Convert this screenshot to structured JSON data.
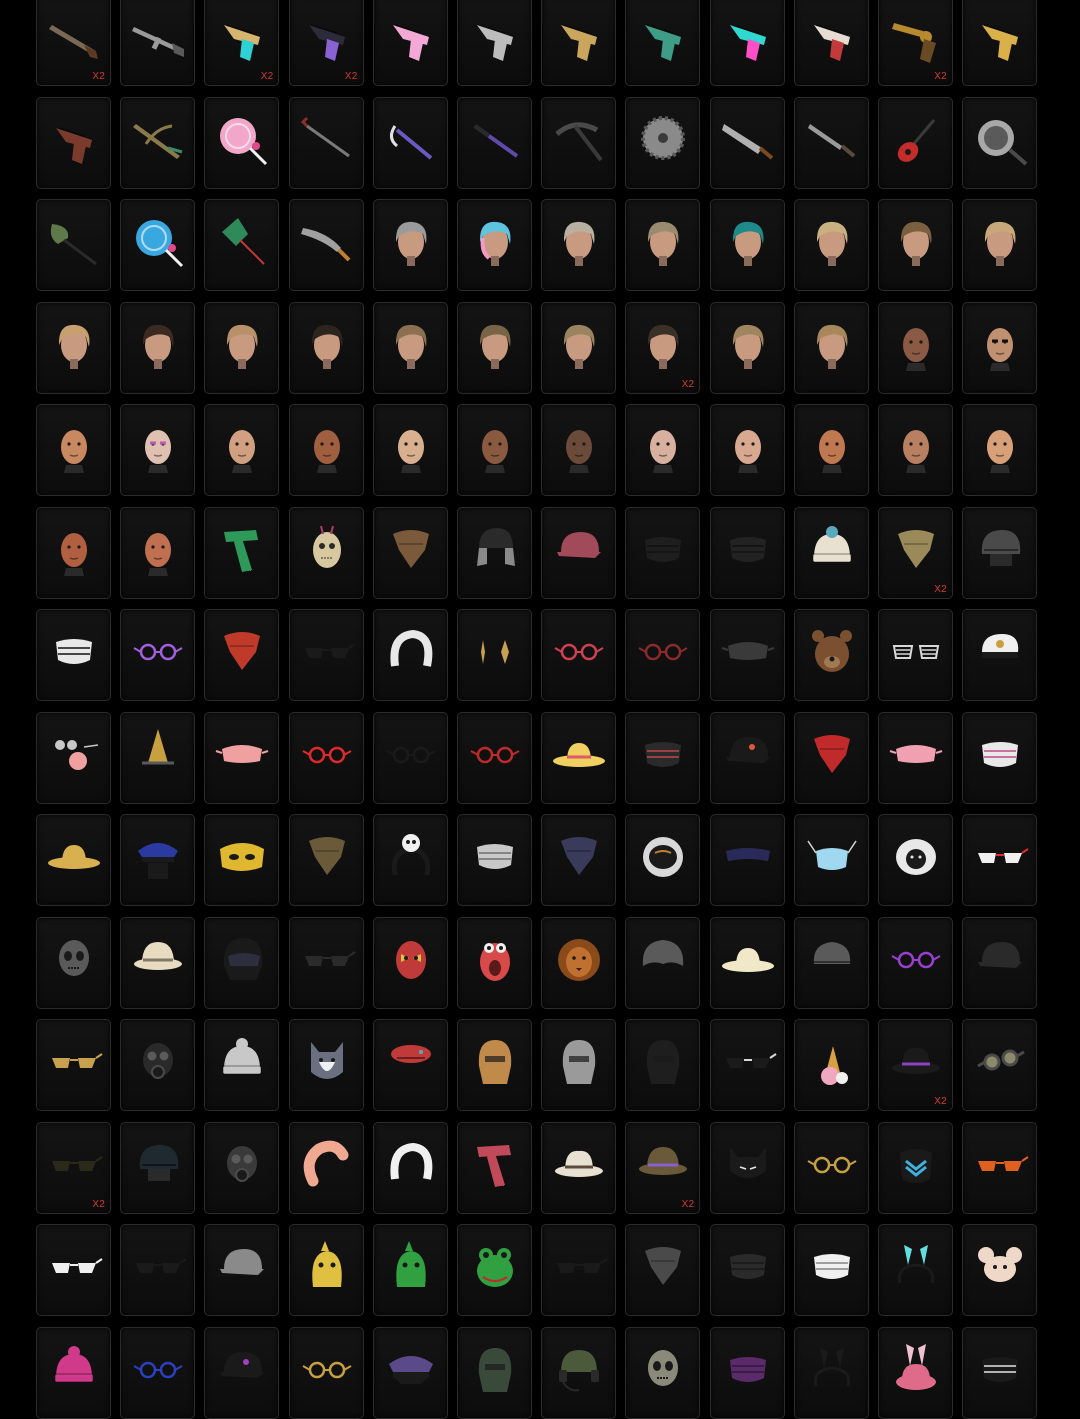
{
  "inventory": {
    "quantity_badge": "X2",
    "colors": {
      "background": "#000000",
      "slot_border": "#2b2b2b",
      "quantity_text": "#d23a2e"
    },
    "items": [
      {
        "icon": "shotgun-icon",
        "color": "#7a6a55"
      },
      {
        "icon": "assault-rifle-icon",
        "color": "#9a9a9a"
      },
      {
        "icon": "pistol-icon",
        "color": "#d6b56e",
        "accent": "#2fd0d6"
      },
      {
        "icon": "pistol-icon",
        "color": "#2b2b3a",
        "accent": "#8a63d2"
      },
      {
        "icon": "pistol-icon",
        "color": "#f3a8d6"
      },
      {
        "icon": "pistol-icon",
        "color": "#bcbcbc"
      },
      {
        "icon": "pistol-icon",
        "color": "#c9a65c"
      },
      {
        "icon": "pistol-icon",
        "color": "#3f9c86"
      },
      {
        "icon": "pistol-icon",
        "color": "#2ed9cf",
        "accent": "#ff4fc8"
      },
      {
        "icon": "pistol-icon",
        "color": "#e6dcd2",
        "accent": "#c33a3a"
      },
      {
        "icon": "revolver-icon",
        "color": "#b88a2e"
      },
      {
        "icon": "pistol-icon",
        "color": "#d9b04a"
      },
      {
        "icon": "pistol-icon",
        "color": "#7a3b2c"
      },
      {
        "icon": "crossbow-icon",
        "color": "#8a7a4a"
      },
      {
        "icon": "lollipop-icon",
        "color": "#f2a6c9"
      },
      {
        "icon": "crowbar-icon",
        "color": "#8a2e2e"
      },
      {
        "icon": "sickle-icon",
        "color": "#6a5ac0"
      },
      {
        "icon": "baton-icon",
        "color": "#5e4aa8"
      },
      {
        "icon": "pickaxe-icon",
        "color": "#4a4a4a"
      },
      {
        "icon": "sawblade-icon",
        "color": "#8a8a8a"
      },
      {
        "icon": "machete-icon",
        "color": "#b0b0b0"
      },
      {
        "icon": "knife-icon",
        "color": "#9a9a9a"
      },
      {
        "icon": "guitar-icon",
        "color": "#c42b2b"
      },
      {
        "icon": "frying-pan-icon",
        "color": "#a8a8a8"
      },
      {
        "icon": "shovel-icon",
        "color": "#5f7a4a"
      },
      {
        "icon": "lollipop-icon",
        "color": "#3aa8e0"
      },
      {
        "icon": "flyswatter-icon",
        "color": "#2f8a5a",
        "accent": "#c43a3a"
      },
      {
        "icon": "kukri-icon",
        "color": "#a0a0a0"
      },
      {
        "icon": "hair-icon",
        "color": "#9a9a9a"
      },
      {
        "icon": "hair-icon",
        "color": "#5fc4e0",
        "accent": "#f29ac4"
      },
      {
        "icon": "hair-icon",
        "color": "#b8b0a0"
      },
      {
        "icon": "hair-icon",
        "color": "#9a8a70"
      },
      {
        "icon": "hair-icon",
        "color": "#1f8a8a"
      },
      {
        "icon": "hair-icon",
        "color": "#c8b080"
      },
      {
        "icon": "hair-icon",
        "color": "#7a6040"
      },
      {
        "icon": "hair-icon",
        "color": "#c8a878"
      },
      {
        "icon": "hair-icon",
        "color": "#c8a070"
      },
      {
        "icon": "hair-icon",
        "color": "#3a2a22"
      },
      {
        "icon": "hair-icon",
        "color": "#b8906a"
      },
      {
        "icon": "hair-icon",
        "color": "#2e241e"
      },
      {
        "icon": "hair-icon",
        "color": "#8a7050"
      },
      {
        "icon": "hair-icon",
        "color": "#7a6448"
      },
      {
        "icon": "hair-icon",
        "color": "#9a8460"
      },
      {
        "icon": "hair-icon",
        "color": "#3a3028"
      },
      {
        "icon": "hair-icon",
        "color": "#a08660"
      },
      {
        "icon": "hair-icon",
        "color": "#a8885a"
      },
      {
        "icon": "face-icon",
        "color": "#8a5a44"
      },
      {
        "icon": "face-icon",
        "color": "#c09070",
        "accent": "#111111"
      },
      {
        "icon": "face-icon",
        "color": "#c88860"
      },
      {
        "icon": "face-icon",
        "color": "#e0c0b0",
        "accent": "#b85ab8"
      },
      {
        "icon": "face-icon",
        "color": "#d0a080"
      },
      {
        "icon": "face-icon",
        "color": "#a06040"
      },
      {
        "icon": "face-icon",
        "color": "#d8b090"
      },
      {
        "icon": "face-icon",
        "color": "#8a5a40"
      },
      {
        "icon": "face-icon",
        "color": "#6a4a38"
      },
      {
        "icon": "face-icon",
        "color": "#d8b0a0"
      },
      {
        "icon": "face-icon",
        "color": "#d8a890"
      },
      {
        "icon": "face-icon",
        "color": "#c07850"
      },
      {
        "icon": "face-icon",
        "color": "#b88060"
      },
      {
        "icon": "face-icon",
        "color": "#d8a078"
      },
      {
        "icon": "face-icon",
        "color": "#b06040"
      },
      {
        "icon": "face-icon",
        "color": "#c07050"
      },
      {
        "icon": "scarf-icon",
        "color": "#2e9a5a"
      },
      {
        "icon": "voodoo-mask-icon",
        "color": "#d8c8a0",
        "accent": "#b03a6a"
      },
      {
        "icon": "bandana-icon",
        "color": "#7a5a3a"
      },
      {
        "icon": "trapper-hat-icon",
        "color": "#2a2a2a"
      },
      {
        "icon": "cap-icon",
        "color": "#a04a5a"
      },
      {
        "icon": "face-mask-icon",
        "color": "#1e1e1e"
      },
      {
        "icon": "face-mask-icon",
        "color": "#222222"
      },
      {
        "icon": "beanie-icon",
        "color": "#e8e0d0",
        "accent": "#5aa8c0"
      },
      {
        "icon": "bandana-icon",
        "color": "#9a8a5a"
      },
      {
        "icon": "helmet-icon",
        "color": "#4a4a4a"
      },
      {
        "icon": "face-mask-icon",
        "color": "#e8e8e8",
        "accent": "#111111"
      },
      {
        "icon": "glasses-icon",
        "color": "#a060e0"
      },
      {
        "icon": "bandana-icon",
        "color": "#c03a2a"
      },
      {
        "icon": "sunglasses-icon",
        "color": "#1a1a1a"
      },
      {
        "icon": "headband-icon",
        "color": "#e8e8e8"
      },
      {
        "icon": "earrings-icon",
        "color": "#c8a050"
      },
      {
        "icon": "glasses-icon",
        "color": "#d04050"
      },
      {
        "icon": "glasses-icon",
        "color": "#8a2a2a"
      },
      {
        "icon": "eye-mask-icon",
        "color": "#3a3a3a"
      },
      {
        "icon": "bear-mask-icon",
        "color": "#7a5030"
      },
      {
        "icon": "shutter-shades-icon",
        "color": "#d8d8d8"
      },
      {
        "icon": "captain-hat-icon",
        "color": "#f0f0f0",
        "accent": "#c8a040"
      },
      {
        "icon": "clown-nose-icon",
        "color": "#f0a0a0"
      },
      {
        "icon": "witch-hat-icon",
        "color": "#c8a040"
      },
      {
        "icon": "eye-mask-icon",
        "color": "#f0a0a0"
      },
      {
        "icon": "glasses-icon",
        "color": "#e02a2a"
      },
      {
        "icon": "glasses-icon",
        "color": "#1a1a1a"
      },
      {
        "icon": "glasses-icon",
        "color": "#c02a2a"
      },
      {
        "icon": "sun-hat-icon",
        "color": "#f0d060",
        "accent": "#e05a6a"
      },
      {
        "icon": "face-mask-icon",
        "color": "#2a2a2a",
        "accent": "#c04a4a"
      },
      {
        "icon": "cap-icon",
        "color": "#1a1a1a",
        "accent": "#e05a3a"
      },
      {
        "icon": "bandana-icon",
        "color": "#c02a2a"
      },
      {
        "icon": "eye-mask-icon",
        "color": "#f0a0b0"
      },
      {
        "icon": "face-mask-icon",
        "color": "#e8e8e8",
        "accent": "#c04a8a"
      },
      {
        "icon": "sun-hat-icon",
        "color": "#d8b050"
      },
      {
        "icon": "police-cap-icon",
        "color": "#2a3aa0"
      },
      {
        "icon": "masquerade-mask-icon",
        "color": "#e0b830"
      },
      {
        "icon": "bandana-icon",
        "color": "#6a5a3a"
      },
      {
        "icon": "panda-headband-icon",
        "color": "#f0f0f0"
      },
      {
        "icon": "face-mask-icon",
        "color": "#c8c8c8"
      },
      {
        "icon": "bandana-icon",
        "color": "#3a3a5a"
      },
      {
        "icon": "space-helmet-icon",
        "color": "#d8d8d8",
        "accent": "#c08030"
      },
      {
        "icon": "visor-icon",
        "color": "#2a2a5a"
      },
      {
        "icon": "medical-mask-icon",
        "color": "#a0d8f0"
      },
      {
        "icon": "sheep-mask-icon",
        "color": "#e8e8e8"
      },
      {
        "icon": "sunglasses-icon",
        "color": "#f0f0f0",
        "accent": "#e02a2a"
      },
      {
        "icon": "skull-mask-icon",
        "color": "#5a5a5a"
      },
      {
        "icon": "pith-helmet-icon",
        "color": "#e8dcc0"
      },
      {
        "icon": "motorcycle-helmet-icon",
        "color": "#1a1a1a"
      },
      {
        "icon": "sunglasses-icon",
        "color": "#2a2a2a"
      },
      {
        "icon": "luchador-mask-icon",
        "color": "#c03a3a",
        "accent": "#e0c040"
      },
      {
        "icon": "monster-mask-icon",
        "color": "#d84a4a"
      },
      {
        "icon": "lion-mask-icon",
        "color": "#c07030"
      },
      {
        "icon": "hood-icon",
        "color": "#5a5a5a"
      },
      {
        "icon": "sun-hat-icon",
        "color": "#f0e8c8"
      },
      {
        "icon": "ushanka-icon",
        "color": "#5a5a5a"
      },
      {
        "icon": "glasses-icon",
        "color": "#9a40d0"
      },
      {
        "icon": "cap-icon",
        "color": "#2a2a2a"
      },
      {
        "icon": "sunglasses-icon",
        "color": "#c8a050"
      },
      {
        "icon": "gas-mask-icon",
        "color": "#2a2a2a"
      },
      {
        "icon": "beanie-icon",
        "color": "#c8c8c8"
      },
      {
        "icon": "husky-mask-icon",
        "color": "#6a7080"
      },
      {
        "icon": "beret-icon",
        "color": "#c03a3a"
      },
      {
        "icon": "balaclava-icon",
        "color": "#c08a4a"
      },
      {
        "icon": "balaclava-icon",
        "color": "#9a9a9a"
      },
      {
        "icon": "balaclava-icon",
        "color": "#1e1e1e"
      },
      {
        "icon": "sunglasses-icon",
        "color": "#1a1a1a",
        "accent": "#d8d8d8"
      },
      {
        "icon": "ice-cream-hat-icon",
        "color": "#f0a8c0",
        "accent": "#d8a040"
      },
      {
        "icon": "fedora-icon",
        "color": "#1a1a1a",
        "accent": "#8a40c0"
      },
      {
        "icon": "goggles-icon",
        "color": "#4a4a4a"
      },
      {
        "icon": "sunglasses-icon",
        "color": "#2a2a1a"
      },
      {
        "icon": "helmet-icon",
        "color": "#1e2a30"
      },
      {
        "icon": "gas-mask-icon",
        "color": "#3a3a3a"
      },
      {
        "icon": "neck-pillow-icon",
        "color": "#f0a890"
      },
      {
        "icon": "headband-icon",
        "color": "#f0f0f0"
      },
      {
        "icon": "scarf-icon",
        "color": "#c04a5a"
      },
      {
        "icon": "fedora-icon",
        "color": "#e8e0d0"
      },
      {
        "icon": "pith-helmet-icon",
        "color": "#6a5a3a",
        "accent": "#8a60d0"
      },
      {
        "icon": "cat-mask-icon",
        "color": "#1a1a1a"
      },
      {
        "icon": "glasses-icon",
        "color": "#c8a040"
      },
      {
        "icon": "cyber-mask-icon",
        "color": "#1a1a1a",
        "accent": "#40b0e0"
      },
      {
        "icon": "sunglasses-icon",
        "color": "#e06020"
      },
      {
        "icon": "sunglasses-icon",
        "color": "#f0f0f0"
      },
      {
        "icon": "sunglasses-icon",
        "color": "#1a1a1a"
      },
      {
        "icon": "cap-icon",
        "color": "#8a8a8a"
      },
      {
        "icon": "dinosaur-mask-icon",
        "color": "#e0c040"
      },
      {
        "icon": "dinosaur-mask-icon",
        "color": "#30a040"
      },
      {
        "icon": "frog-mask-icon",
        "color": "#30a040"
      },
      {
        "icon": "sunglasses-icon",
        "color": "#1a1a1a"
      },
      {
        "icon": "bandana-icon",
        "color": "#4a4a4a"
      },
      {
        "icon": "face-mask-icon",
        "color": "#2a2a2a"
      },
      {
        "icon": "face-mask-icon",
        "color": "#f0f0f0"
      },
      {
        "icon": "bunny-ears-icon",
        "color": "#1a1a1a",
        "accent": "#60e0e0"
      },
      {
        "icon": "mouse-mask-icon",
        "color": "#f0d8c8"
      },
      {
        "icon": "beanie-icon",
        "color": "#d03a8a"
      },
      {
        "icon": "glasses-icon",
        "color": "#2a40c0"
      },
      {
        "icon": "cap-icon",
        "color": "#1a1a1a",
        "accent": "#a040c0"
      },
      {
        "icon": "glasses-icon",
        "color": "#c8a040"
      },
      {
        "icon": "officer-cap-icon",
        "color": "#5a4a8a"
      },
      {
        "icon": "balaclava-icon",
        "color": "#3a4a3a"
      },
      {
        "icon": "headset-helmet-icon",
        "color": "#4a5a3a"
      },
      {
        "icon": "skull-mask-icon",
        "color": "#8a8a7a"
      },
      {
        "icon": "face-mask-icon",
        "color": "#5a2a6a"
      },
      {
        "icon": "bunny-ears-icon",
        "color": "#1a1a1a"
      },
      {
        "icon": "bunny-hat-icon",
        "color": "#e06a8a"
      },
      {
        "icon": "face-mask-icon",
        "color": "#1a1a1a",
        "accent": "#e8e8e8"
      }
    ],
    "quantity_slots": [
      0,
      2,
      3,
      10,
      43,
      70,
      130,
      132,
      139
    ]
  }
}
